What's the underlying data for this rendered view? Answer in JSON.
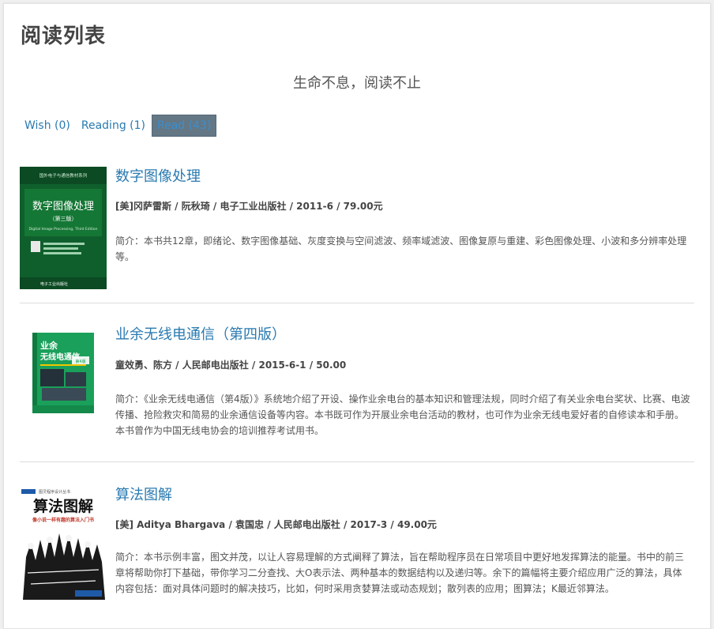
{
  "header": {
    "title": "阅读列表",
    "motto": "生命不息，阅读不止"
  },
  "tabs": [
    {
      "label": "Wish (0)",
      "active": false
    },
    {
      "label": "Reading (1)",
      "active": false
    },
    {
      "label": "Read (43)",
      "active": true
    }
  ],
  "books": [
    {
      "title": "数字图像处理",
      "meta": "[美]冈萨雷斯 / 阮秋琦 / 电子工业出版社 / 2011-6 / 79.00元",
      "summary": "简介：本书共12章，即绪论、数字图像基础、灰度变换与空间滤波、频率域滤波、图像复原与重建、彩色图像处理、小波和多分辨率处理等。",
      "cover": {
        "series": "国外电子与通信教材系列",
        "title": "数字图像处理",
        "edition": "（第三版）",
        "en_title": "Digital Image Processing, Third Edition",
        "publisher_logo": "电子工业出版社",
        "colors": {
          "bg": "#0f5f2c",
          "accent": "#1c8a3e"
        }
      }
    },
    {
      "title": "业余无线电通信（第四版）",
      "meta": "童效勇、陈方 / 人民邮电出版社 / 2015-6-1 / 50.00",
      "summary": "简介：《业余无线电通信（第4版）》系统地介绍了开设、操作业余电台的基本知识和管理法规，同时介绍了有关业余电台奖状、比赛、电波传播、抢险救灾和简易的业余通信设备等内容。本书既可作为开展业余电台活动的教材，也可作为业余无线电爱好者的自修读本和手册。本书曾作为中国无线电协会的培训推荐考试用书。",
      "cover": {
        "title_line1": "业余",
        "title_line2": "无线电通信",
        "edition": "第4版",
        "colors": {
          "bg": "#1aa05a",
          "accent": "#f2c500"
        }
      }
    },
    {
      "title": "算法图解",
      "meta": "[美] Aditya Bhargava / 袁国忠 / 人民邮电出版社 / 2017-3 / 49.00元",
      "summary": "简介：本书示例丰富，图文并茂，以让人容易理解的方式阐释了算法，旨在帮助程序员在日常项目中更好地发挥算法的能量。书中的前三章将帮助你打下基础，带你学习二分查找、大O表示法、两种基本的数据结构以及递归等。余下的篇幅将主要介绍应用广泛的算法，具体内容包括：面对具体问题时的解决技巧，比如，何时采用贪婪算法或动态规划；散列表的应用；图算法；K最近邻算法。",
      "cover": {
        "series": "图灵程序设计丛书",
        "title": "算法图解",
        "subtitle": "像小说一样有趣的算法入门书",
        "colors": {
          "bg": "#ffffff",
          "accent": "#c0392b"
        }
      }
    }
  ]
}
